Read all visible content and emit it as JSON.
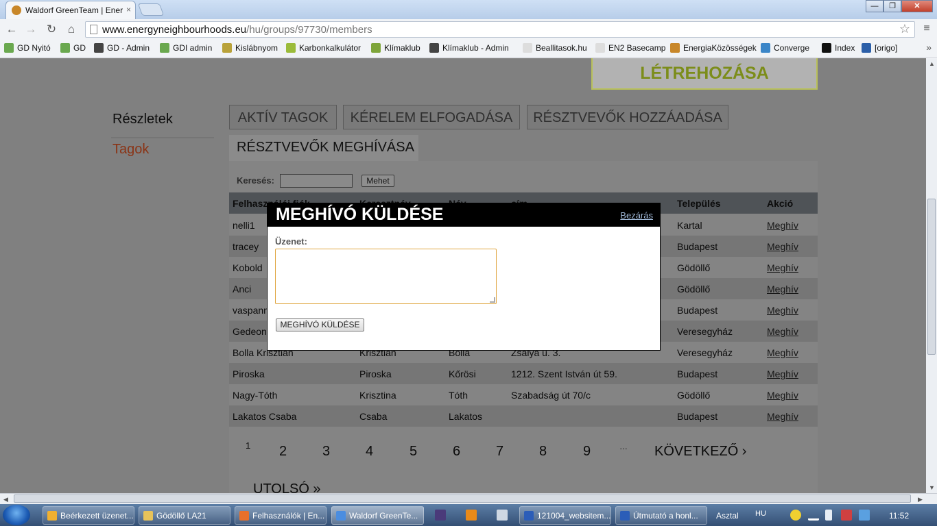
{
  "browser": {
    "tab_title": "Waldorf GreenTeam | Ener",
    "tab_close": "×",
    "url_host": "www.energyneighbourhoods.eu",
    "url_path": "/hu/groups/97730/members",
    "window_buttons": {
      "minimize": "—",
      "maximize": "❐",
      "close": "✕"
    },
    "nav_icons": {
      "back": "←",
      "forward": "→",
      "reload": "↻",
      "home": "⌂",
      "star": "☆",
      "menu": "≡"
    },
    "bookmarks": [
      {
        "label": "GD Nyitó",
        "color": "#6aa84f"
      },
      {
        "label": "GD",
        "color": "#6aa84f"
      },
      {
        "label": "GD - Admin",
        "color": "#444444"
      },
      {
        "label": "GDI admin",
        "color": "#6aa84f"
      },
      {
        "label": "Kislábnyom",
        "color": "#b9a23a"
      },
      {
        "label": "Karbonkalkulátor",
        "color": "#9bbb3a"
      },
      {
        "label": "Klímaklub",
        "color": "#7ea53a"
      },
      {
        "label": "Klímaklub - Admin",
        "color": "#444444"
      },
      {
        "label": "Beallitasok.hu",
        "color": "#dddddd"
      },
      {
        "label": "EN2 Basecamp",
        "color": "#dddddd"
      },
      {
        "label": "EnergiaKözösségek",
        "color": "#c8872a"
      },
      {
        "label": "Converge",
        "color": "#3b86c8"
      },
      {
        "label": "Index",
        "color": "#111111"
      },
      {
        "label": "[origo]",
        "color": "#2c5fa8"
      }
    ],
    "bookmarks_more": "»"
  },
  "page": {
    "create_button": "LÉTREHOZÁSA",
    "sidebar": {
      "details": "Részletek",
      "members": "Tagok"
    },
    "tabs": {
      "active_members": "AKTÍV TAGOK",
      "accept_requests": "KÉRELEM ELFOGADÁSA",
      "add_participants": "RÉSZTVEVŐK HOZZÁADÁSA",
      "invite_participants": "RÉSZTVEVŐK MEGHÍVÁSA"
    },
    "search": {
      "label": "Keresés:",
      "value": "",
      "button": "Mehet"
    },
    "table": {
      "headers": [
        "Felhasználói fiók",
        "Keresztnév",
        "Név",
        "cím",
        "Település",
        "Akció"
      ],
      "rows": [
        {
          "account": "nelli1",
          "first": "",
          "last": "",
          "address": "",
          "town": "Kartal",
          "action": "Meghív"
        },
        {
          "account": "tracey",
          "first": "",
          "last": "",
          "address": "",
          "town": "Budapest",
          "action": "Meghív"
        },
        {
          "account": "Kobold",
          "first": "",
          "last": "",
          "address": "",
          "town": "Gödöllő",
          "action": "Meghív"
        },
        {
          "account": "Anci",
          "first": "",
          "last": "",
          "address": "",
          "town": "Gödöllő",
          "action": "Meghív"
        },
        {
          "account": "vaspanna",
          "first": "",
          "last": "",
          "address": "",
          "town": "Budapest",
          "action": "Meghív"
        },
        {
          "account": "Gedeon",
          "first": "",
          "last": "",
          "address": "",
          "town": "Veresegyház",
          "action": "Meghív"
        },
        {
          "account": "Bolla Krisztián",
          "first": "Krisztián",
          "last": "Bolla",
          "address": "Zsálya u. 3.",
          "town": "Veresegyház",
          "action": "Meghív"
        },
        {
          "account": "Piroska",
          "first": "Piroska",
          "last": "Kőrösi",
          "address": "1212. Szent István út 59.",
          "town": "Budapest",
          "action": "Meghív"
        },
        {
          "account": "Nagy-Tóth",
          "first": "Krisztina",
          "last": "Tóth",
          "address": "Szabadság út 70/c",
          "town": "Gödöllő",
          "action": "Meghív"
        },
        {
          "account": "Lakatos Csaba",
          "first": "Csaba",
          "last": "Lakatos",
          "address": "",
          "town": "Budapest",
          "action": "Meghív"
        }
      ]
    },
    "pager": {
      "current": "1",
      "pages": [
        "2",
        "3",
        "4",
        "5",
        "6",
        "7",
        "8",
        "9"
      ],
      "ellipsis": "…",
      "next": "KÖVETKEZŐ ›",
      "last": "UTOLSÓ »"
    }
  },
  "modal": {
    "title": "MEGHÍVÓ KÜLDÉSE",
    "close": "Bezárás",
    "message_label": "Üzenet:",
    "message_value": "",
    "send_button": "MEGHÍVÓ KÜLDÉSE"
  },
  "taskbar": {
    "items": [
      {
        "label": "Beérkezett üzenet...",
        "color": "#f0b030"
      },
      {
        "label": "Gödöllő LA21",
        "color": "#e8c35a"
      },
      {
        "label": "Felhasználók | En...",
        "color": "#e8702a"
      },
      {
        "label": "Waldorf GreenTe...",
        "color": "#4a8de0"
      },
      {
        "label": "121004_websitem...",
        "color": "#2b5db8"
      },
      {
        "label": "Útmutató a honl...",
        "color": "#2b5db8"
      }
    ],
    "desktop_label": "Asztal",
    "language": "HU",
    "clock": "11:52"
  }
}
